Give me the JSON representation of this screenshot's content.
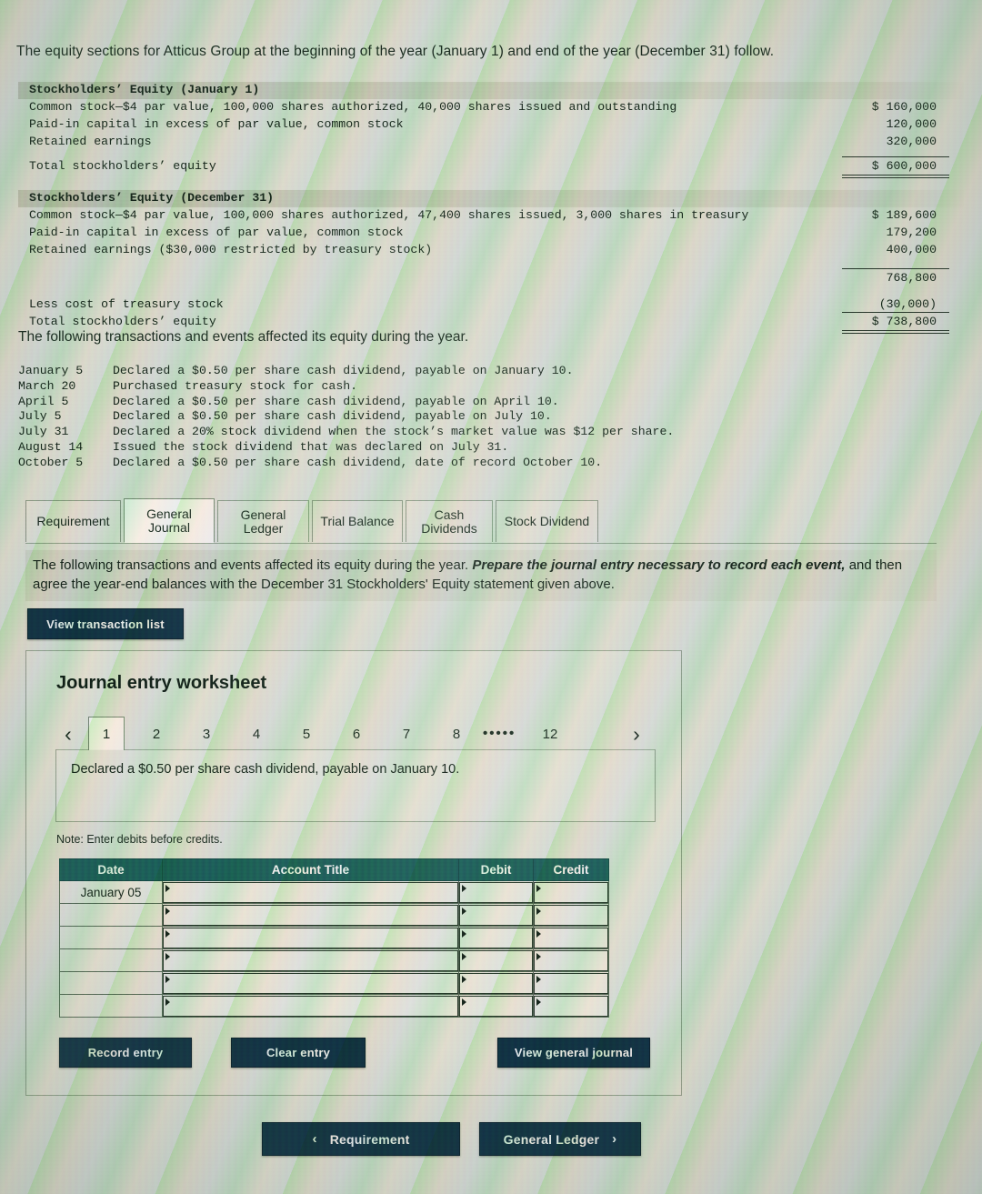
{
  "intro": "The equity sections for Atticus Group at the beginning of the year (January 1) and end of the year (December 31) follow.",
  "equity_jan": {
    "heading": "Stockholders’ Equity (January 1)",
    "rows": [
      {
        "label": "Common stock—$4 par value, 100,000 shares authorized, 40,000 shares issued and outstanding",
        "amount": "$ 160,000"
      },
      {
        "label": "Paid-in capital in excess of par value, common stock",
        "amount": "120,000"
      },
      {
        "label": "Retained earnings",
        "amount": "320,000"
      },
      {
        "label": "Total stockholders’ equity",
        "amount": "$ 600,000"
      }
    ]
  },
  "equity_dec": {
    "heading": "Stockholders’ Equity (December 31)",
    "rows": [
      {
        "label": "Common stock—$4 par value, 100,000 shares authorized, 47,400 shares issued, 3,000 shares in treasury",
        "amount": "$ 189,600"
      },
      {
        "label": "Paid-in capital in excess of par value, common stock",
        "amount": "179,200"
      },
      {
        "label": "Retained earnings ($30,000 restricted by treasury stock)",
        "amount": "400,000"
      },
      {
        "label": "",
        "amount": "768,800"
      },
      {
        "label": "Less cost of treasury stock",
        "amount": "(30,000)"
      },
      {
        "label": "Total stockholders’ equity",
        "amount": "$ 738,800"
      }
    ]
  },
  "transactions_heading": "The following transactions and events affected its equity during the year.",
  "transactions": [
    {
      "date": "January 5",
      "desc": "Declared a $0.50 per share cash dividend, payable on January 10."
    },
    {
      "date": "March 20",
      "desc": "Purchased treasury stock for cash."
    },
    {
      "date": "April 5",
      "desc": "Declared a $0.50 per share cash dividend, payable on April 10."
    },
    {
      "date": "July 5",
      "desc": "Declared a $0.50 per share cash dividend, payable on July 10."
    },
    {
      "date": "July 31",
      "desc": "Declared a 20% stock dividend when the stock’s market value was $12 per share."
    },
    {
      "date": "August 14",
      "desc": "Issued the stock dividend that was declared on July 31."
    },
    {
      "date": "October 5",
      "desc": "Declared a $0.50 per share cash dividend, date of record October 10."
    }
  ],
  "tabs": [
    {
      "label": "Requirement",
      "active": false
    },
    {
      "label": "General Journal",
      "active": true
    },
    {
      "label": "General Ledger",
      "active": false
    },
    {
      "label": "Trial Balance",
      "active": false
    },
    {
      "label": "Cash Dividends",
      "active": false
    },
    {
      "label": "Stock Dividend",
      "active": false
    }
  ],
  "requirement": {
    "text_plain_1": "The following transactions and events affected its equity during the year.",
    "text_emphasis": "Prepare the journal entry necessary to record each event,",
    "text_plain_2": "and then agree the year-end balances with the December 31 Stockholders' Equity statement given above.",
    "view_transaction_list": "View transaction list"
  },
  "worksheet": {
    "title": "Journal entry worksheet",
    "pager": {
      "prev": "‹",
      "next": "›",
      "pages": [
        "1",
        "2",
        "3",
        "4",
        "5",
        "6",
        "7",
        "8"
      ],
      "ellipsis": "•••••",
      "last": "12",
      "active_page": "1"
    },
    "event_text": "Declared a $0.50 per share cash dividend, payable on January 10.",
    "note": "Note: Enter debits before credits.",
    "table": {
      "columns": [
        "Date",
        "Account Title",
        "Debit",
        "Credit"
      ],
      "rows": [
        {
          "date": "January 05",
          "account": "",
          "debit": "",
          "credit": ""
        },
        {
          "date": "",
          "account": "",
          "debit": "",
          "credit": ""
        },
        {
          "date": "",
          "account": "",
          "debit": "",
          "credit": ""
        },
        {
          "date": "",
          "account": "",
          "debit": "",
          "credit": ""
        },
        {
          "date": "",
          "account": "",
          "debit": "",
          "credit": ""
        },
        {
          "date": "",
          "account": "",
          "debit": "",
          "credit": ""
        }
      ]
    },
    "buttons": {
      "record_entry": "Record entry",
      "clear_entry": "Clear entry",
      "view_general_journal": "View general journal"
    }
  },
  "footer_nav": {
    "prev_label": "Requirement",
    "prev_chevron": "‹",
    "next_label": "General Ledger",
    "next_chevron": "›"
  },
  "colors": {
    "button_navy": "#123349",
    "table_header_teal": "#1d5f5f",
    "page_background": "#dfe3dc"
  }
}
